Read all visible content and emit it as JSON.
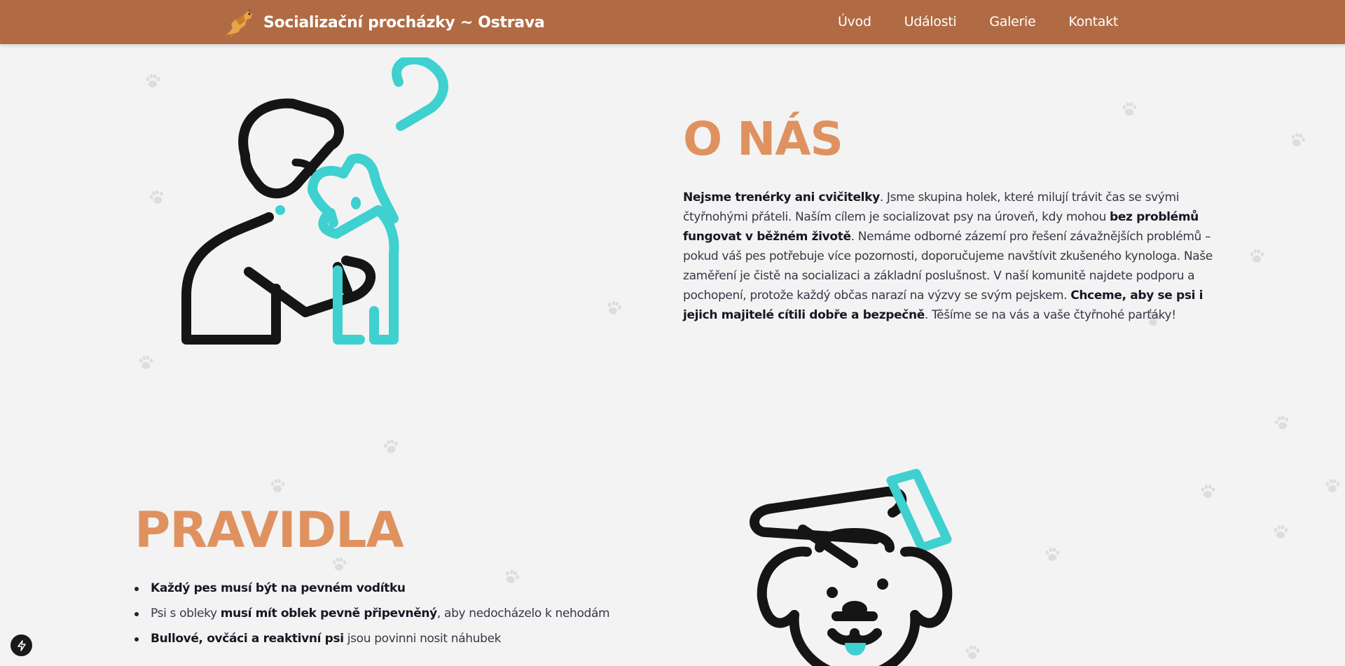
{
  "header": {
    "title": "Socializační procházky ~ Ostrava",
    "nav": [
      "Úvod",
      "Události",
      "Galerie",
      "Kontakt"
    ]
  },
  "about": {
    "heading": "O NÁS",
    "p": [
      {
        "t": "Nejsme trenérky ani cvičitelky",
        "b": true
      },
      {
        "t": ". Jsme skupina holek, které milují trávit čas se svými čtyřnohými přáteli. Naším cílem je socializovat psy na úroveň, kdy mohou ",
        "b": false
      },
      {
        "t": "bez problémů fungovat v běžném životě",
        "b": true
      },
      {
        "t": ". Nemáme odborné zázemí pro řešení závažnějších problémů – pokud váš pes potřebuje více pozornosti, doporučujeme navštívit zkušeného kynologa. Naše zaměření je čistě na socializaci a základní poslušnost. V naší komunitě najdete podporu a pochopení, protože každý občas narazí na výzvy se svým pejskem. ",
        "b": false
      },
      {
        "t": "Chceme, aby se psi i jejich majitelé cítili dobře a bezpečně",
        "b": true
      },
      {
        "t": ". Těšíme se na vás a vaše čtyřnohé parťáky!",
        "b": false
      }
    ]
  },
  "rules": {
    "heading": "PRAVIDLA",
    "items": [
      [
        {
          "t": "Každý pes musí být na pevném vodítku",
          "b": true
        }
      ],
      [
        {
          "t": "Psi s obleky ",
          "b": false
        },
        {
          "t": "musí mít oblek pevně připevněný",
          "b": true
        },
        {
          "t": ", aby nedocházelo k nehodám",
          "b": false
        }
      ],
      [
        {
          "t": "Bullové, ovčáci a reaktivní psi",
          "b": true
        },
        {
          "t": " jsou povinni nosit náhubek",
          "b": false
        }
      ]
    ]
  },
  "colors": {
    "header_bg": "#b06b45",
    "accent": "#df925f",
    "teal": "#3fd0d0",
    "dark": "#151515"
  },
  "icons": [
    "dog-logo-icon",
    "paw-icon",
    "bolt-icon",
    "person-hugging-dog-illustration",
    "hand-petting-dog-illustration"
  ]
}
